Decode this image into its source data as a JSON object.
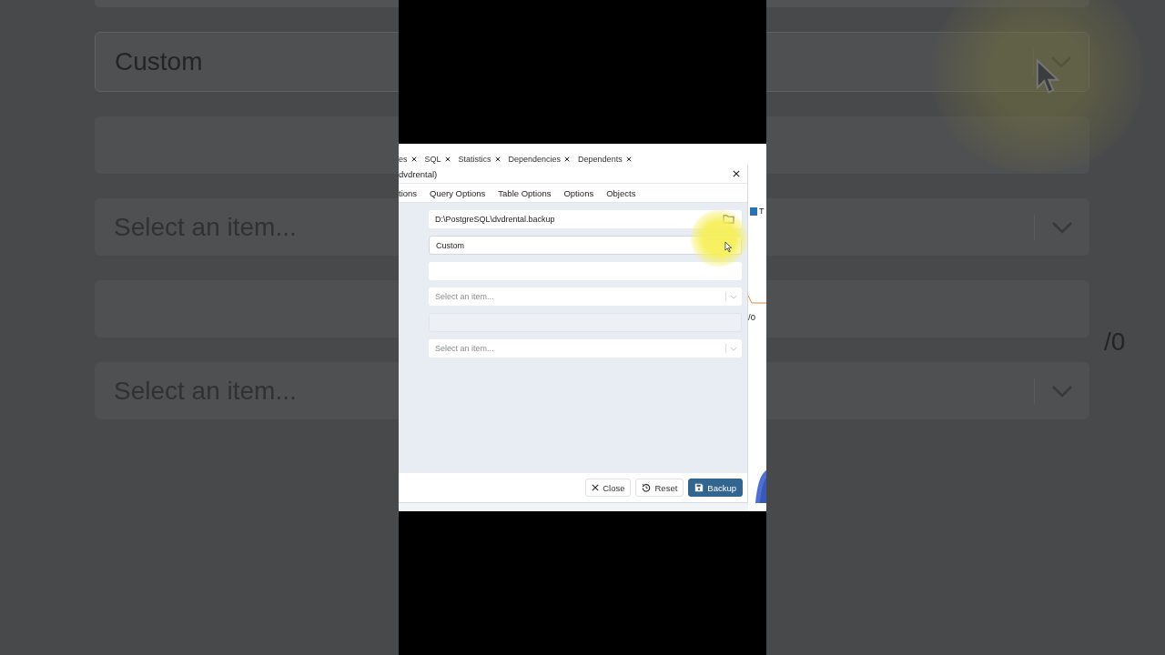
{
  "background": {
    "fields": [
      {
        "kind": "select",
        "value": "Custom"
      },
      {
        "kind": "input"
      },
      {
        "kind": "select",
        "placeholder": "Select an item..."
      },
      {
        "kind": "input"
      },
      {
        "kind": "select",
        "placeholder": "Select an item..."
      }
    ],
    "side_label": "/0"
  },
  "app_tabs": [
    {
      "label": "es"
    },
    {
      "label": "SQL"
    },
    {
      "label": "Statistics"
    },
    {
      "label": "Dependencies"
    },
    {
      "label": "Dependents"
    }
  ],
  "dialog": {
    "title": "dvdrental)",
    "tabs": [
      {
        "label": "tions"
      },
      {
        "label": "Query Options"
      },
      {
        "label": "Table Options"
      },
      {
        "label": "Options"
      },
      {
        "label": "Objects"
      }
    ],
    "fields": [
      {
        "kind": "file",
        "value": "D:\\PostgreSQL\\dvdrental.backup"
      },
      {
        "kind": "select",
        "value": "Custom"
      },
      {
        "kind": "input",
        "disabled": false
      },
      {
        "kind": "select",
        "placeholder": "Select an item..."
      },
      {
        "kind": "input",
        "disabled": true
      },
      {
        "kind": "select",
        "placeholder": "Select an item..."
      }
    ],
    "buttons": [
      {
        "label": "Close",
        "kind": "close"
      },
      {
        "label": "Reset",
        "kind": "reset"
      },
      {
        "label": "Backup",
        "kind": "primary"
      }
    ]
  },
  "side_panel": {
    "legend": "T",
    "label": "/0"
  }
}
